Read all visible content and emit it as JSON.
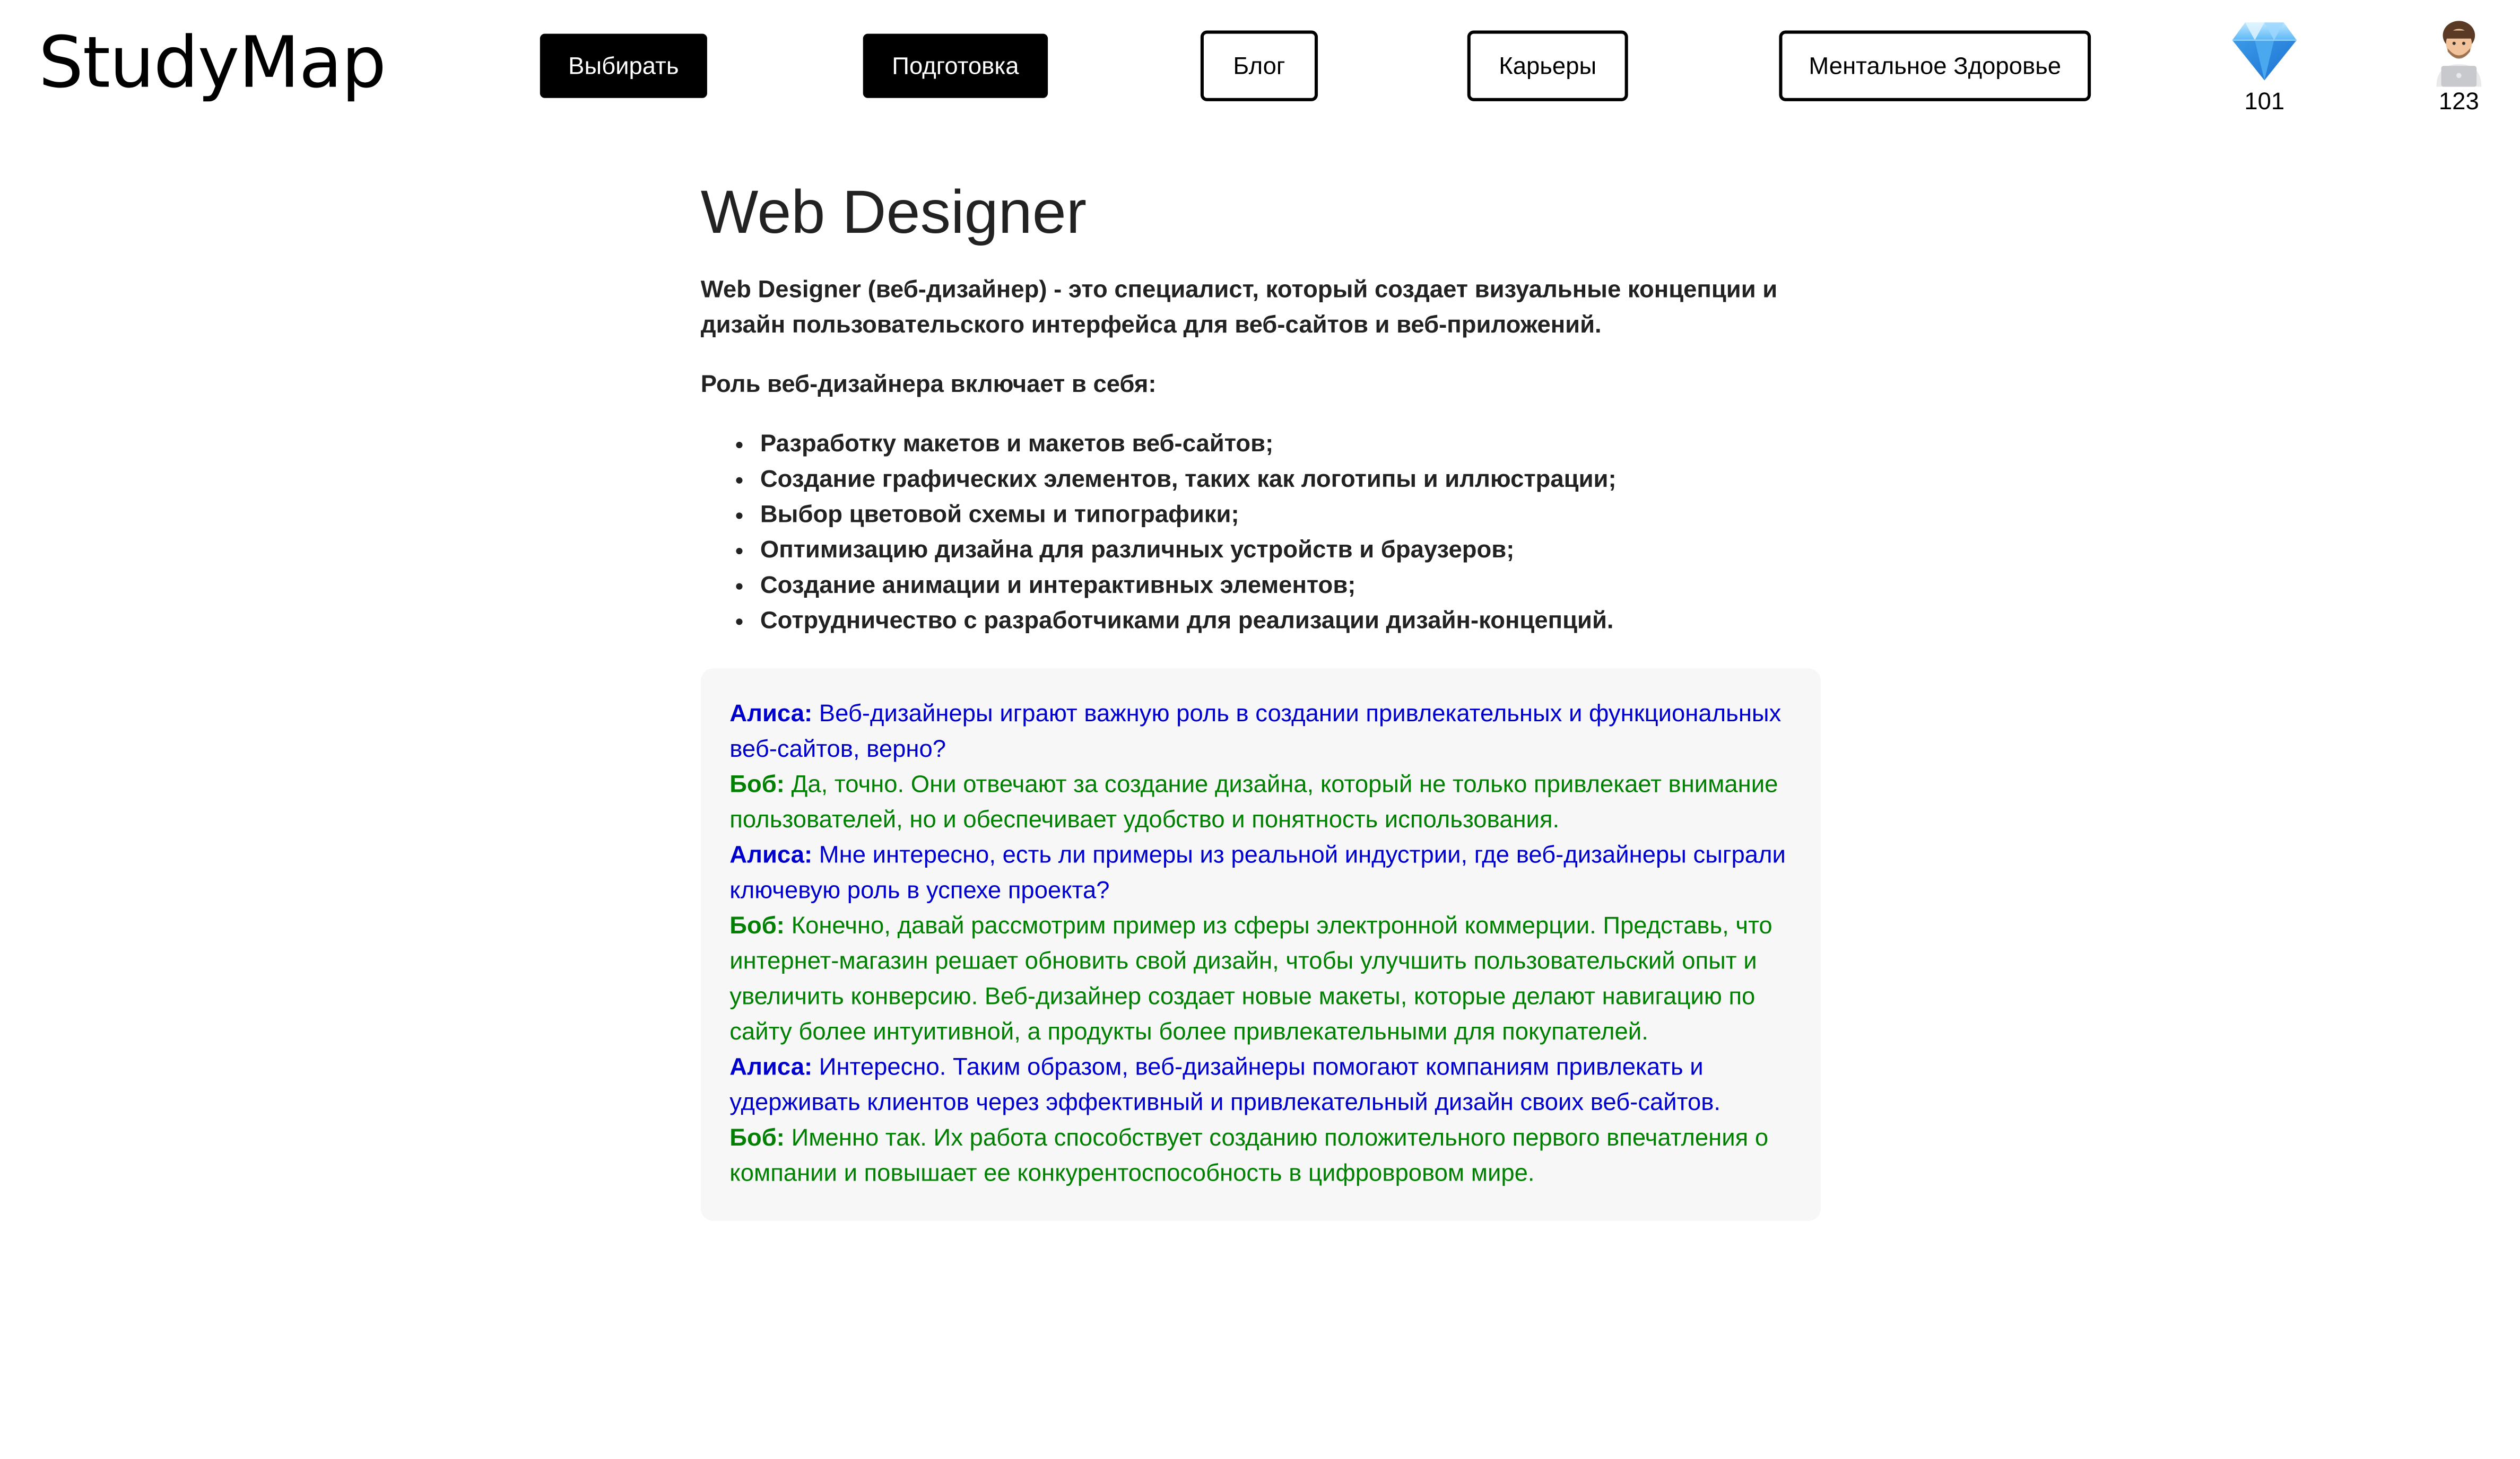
{
  "header": {
    "logo": "StudyMap",
    "nav": [
      {
        "label": "Выбирать",
        "style": "filled"
      },
      {
        "label": "Подготовка",
        "style": "filled"
      },
      {
        "label": "Блог",
        "style": "outline"
      },
      {
        "label": "Карьеры",
        "style": "outline"
      },
      {
        "label": "Ментальное Здоровье",
        "style": "outline"
      }
    ],
    "gems": {
      "icon": "gem-icon",
      "value": "101"
    },
    "profile": {
      "icon": "avatar-icon",
      "value": "123"
    }
  },
  "main": {
    "title": "Web Designer",
    "intro": "Web Designer (веб-дизайнер) - это специалист, который создает визуальные концепции и дизайн пользовательского интерфейса для веб-сайтов и веб-приложений.",
    "role_heading": "Роль веб-дизайнера включает в себя:",
    "roles": [
      "Разработку макетов и макетов веб-сайтов;",
      "Создание графических элементов, таких как логотипы и иллюстрации;",
      "Выбор цветовой схемы и типографики;",
      "Оптимизацию дизайна для различных устройств и браузеров;",
      "Создание анимации и интерактивных элементов;",
      "Сотрудничество с разработчиками для реализации дизайн-концепций."
    ],
    "dialog": [
      {
        "speaker": "Алиса:",
        "text": "Веб-дизайнеры играют важную роль в создании привлекательных и функциональных веб-сайтов, верно?"
      },
      {
        "speaker": "Боб:",
        "text": "Да, точно. Они отвечают за создание дизайна, который не только привлекает внимание пользователей, но и обеспечивает удобство и понятность использования."
      },
      {
        "speaker": "Алиса:",
        "text": "Мне интересно, есть ли примеры из реальной индустрии, где веб-дизайнеры сыграли ключевую роль в успехе проекта?"
      },
      {
        "speaker": "Боб:",
        "text": "Конечно, давай рассмотрим пример из сферы электронной коммерции. Представь, что интернет-магазин решает обновить свой дизайн, чтобы улучшить пользовательский опыт и увеличить конверсию. Веб-дизайнер создает новые макеты, которые делают навигацию по сайту более интуитивной, а продукты более привлекательными для покупателей."
      },
      {
        "speaker": "Алиса:",
        "text": "Интересно. Таким образом, веб-дизайнеры помогают компаниям привлекать и удерживать клиентов через эффективный и привлекательный дизайн своих веб-сайтов."
      },
      {
        "speaker": "Боб:",
        "text": "Именно так. Их работа способствует созданию положительного первого впечатления о компании и повышает ее конкурентоспособность в цифровровом мире."
      }
    ]
  },
  "colors": {
    "alice": "#0000cc",
    "bob": "#008000",
    "dialog_bg": "#f7f7f7",
    "nav_filled_bg": "#000000"
  }
}
